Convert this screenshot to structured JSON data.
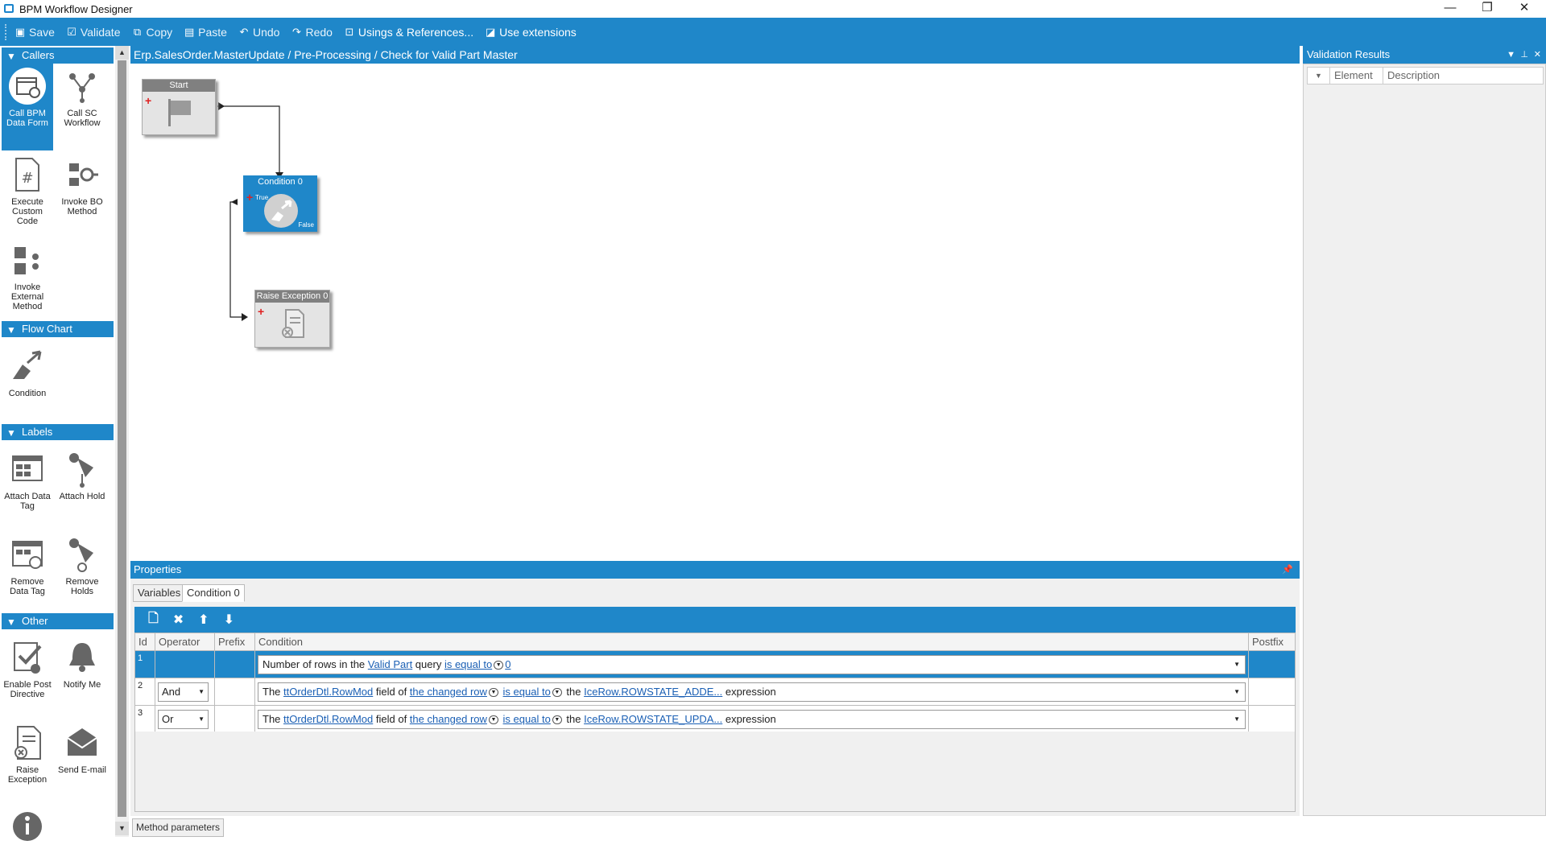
{
  "window": {
    "title": "BPM Workflow Designer",
    "minimize": "—",
    "restore": "❐",
    "close": "✕"
  },
  "toolbar": {
    "save": "Save",
    "validate": "Validate",
    "copy": "Copy",
    "paste": "Paste",
    "undo": "Undo",
    "redo": "Redo",
    "usings": "Usings & References...",
    "extensions": "Use extensions"
  },
  "toolbox": {
    "categories": [
      {
        "label": "Callers"
      },
      {
        "label": "Flow Chart"
      },
      {
        "label": "Labels"
      },
      {
        "label": "Other"
      }
    ],
    "items": {
      "call_bpm_data_form": "Call BPM Data Form",
      "call_sc_workflow": "Call SC Workflow",
      "execute_custom_code": "Execute Custom Code",
      "invoke_bo_method": "Invoke BO Method",
      "invoke_external_method": "Invoke External Method",
      "condition": "Condition",
      "attach_data_tag": "Attach Data Tag",
      "attach_hold": "Attach Hold",
      "remove_data_tag": "Remove Data Tag",
      "remove_holds": "Remove Holds",
      "enable_post_directive": "Enable Post Directive",
      "notify_me": "Notify Me",
      "raise_exception": "Raise Exception",
      "send_email": "Send E-mail"
    }
  },
  "canvas": {
    "breadcrumb": "Erp.SalesOrder.MasterUpdate / Pre-Processing / Check for Valid Part Master",
    "nodes": {
      "start": "Start",
      "condition": "Condition 0",
      "raise": "Raise Exception 0"
    },
    "ports": {
      "true": "True",
      "false": "False"
    }
  },
  "properties": {
    "title": "Properties",
    "tabs": {
      "variables": "Variables",
      "condition": "Condition 0"
    },
    "columns": {
      "id": "Id",
      "operator": "Operator",
      "prefix": "Prefix",
      "condition": "Condition",
      "postfix": "Postfix"
    },
    "rows": [
      {
        "id": "1",
        "operator": "",
        "text1": "Number of rows in the ",
        "link1": "Valid Part",
        "text2": " query ",
        "link2": "is equal to",
        "link3": "0"
      },
      {
        "id": "2",
        "operator": "And",
        "text1": "The ",
        "link1": "ttOrderDtl.RowMod",
        "text2": " field of ",
        "link2": "the changed row",
        "link3": "is equal to",
        "text3": " the ",
        "link4": "IceRow.ROWSTATE_ADDE...",
        "text4": " expression"
      },
      {
        "id": "3",
        "operator": "Or",
        "text1": "The ",
        "link1": "ttOrderDtl.RowMod",
        "text2": " field of ",
        "link2": "the changed row",
        "link3": "is equal to",
        "text3": " the ",
        "link4": "IceRow.ROWSTATE_UPDA...",
        "text4": " expression"
      }
    ],
    "status_tab": "Method parameters"
  },
  "validation": {
    "title": "Validation Results",
    "columns": {
      "element": "Element",
      "description": "Description"
    }
  }
}
